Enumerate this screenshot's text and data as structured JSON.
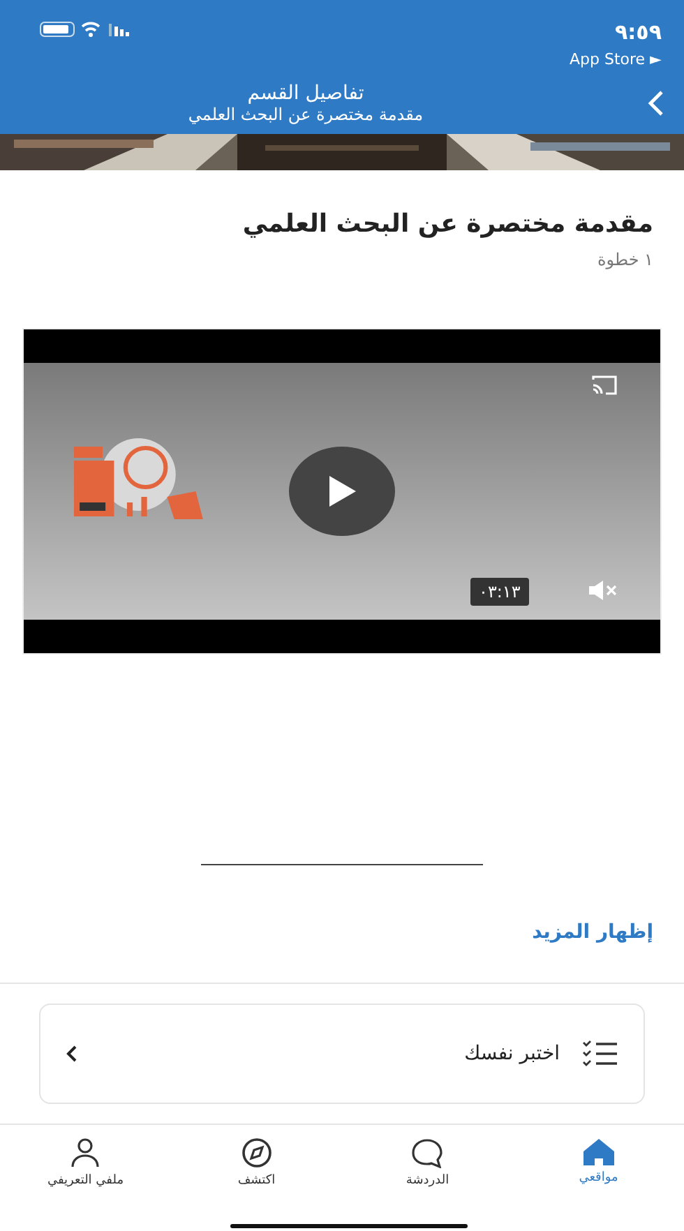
{
  "status_bar": {
    "time": "٩:٥٩",
    "back_app": "App Store ►"
  },
  "header": {
    "title": "تفاصيل القسم",
    "subtitle": "مقدمة مختصرة عن البحث العلمي"
  },
  "section": {
    "title": "مقدمة مختصرة عن البحث العلمي",
    "steps": "١ خطوة"
  },
  "video": {
    "kind": "picture",
    "duration": "٠٣:١٣",
    "muted": true
  },
  "show_more": "إظهار المزيد",
  "quiz_card": {
    "label": "اختبر نفسك"
  },
  "tabs": [
    {
      "label": "مواقعي",
      "kind": "home",
      "selected": true
    },
    {
      "label": "الدردشة",
      "kind": "chat",
      "selected": false
    },
    {
      "label": "اكتشف",
      "kind": "compass",
      "selected": false
    },
    {
      "label": "ملفي التعريفي",
      "kind": "user",
      "selected": false
    }
  ]
}
